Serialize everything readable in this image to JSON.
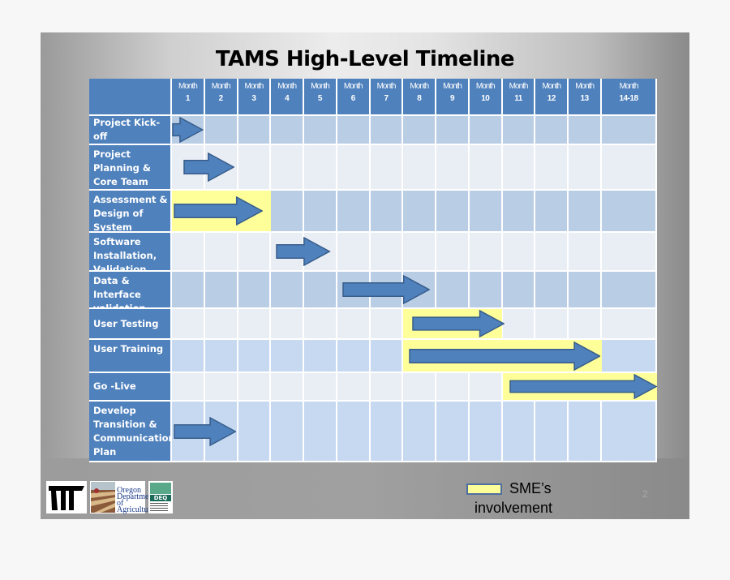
{
  "slide": {
    "title": "TAMS High-Level Timeline",
    "page_number": "2"
  },
  "header": {
    "corner": "",
    "months": [
      {
        "line1": "Month",
        "line2": "1"
      },
      {
        "line1": "Month",
        "line2": "2"
      },
      {
        "line1": "Month",
        "line2": "3"
      },
      {
        "line1": "Month",
        "line2": "4"
      },
      {
        "line1": "Month",
        "line2": "5"
      },
      {
        "line1": "Month",
        "line2": "6"
      },
      {
        "line1": "Month",
        "line2": "7"
      },
      {
        "line1": "Month",
        "line2": "8"
      },
      {
        "line1": "Month",
        "line2": "9"
      },
      {
        "line1": "Month",
        "line2": "10"
      },
      {
        "line1": "Month",
        "line2": "11"
      },
      {
        "line1": "Month",
        "line2": "12"
      },
      {
        "line1": "Month",
        "line2": "13"
      },
      {
        "line1": "Month",
        "line2": "14-18"
      }
    ]
  },
  "tasks": [
    {
      "label": "Project Kick-off",
      "arrow_start_month": 1.0,
      "arrow_end_month": 1.95,
      "sme_start_month": null,
      "sme_end_month": null
    },
    {
      "label": "Project Planning & Core Team Training",
      "arrow_start_month": 1.35,
      "arrow_end_month": 2.9,
      "sme_start_month": null,
      "sme_end_month": null
    },
    {
      "label": "Assessment & Design of System",
      "arrow_start_month": 1.05,
      "arrow_end_month": 3.75,
      "sme_start_month": 1.0,
      "sme_end_month": 3.99
    },
    {
      "label": "Software Installation, Validation",
      "arrow_start_month": 4.15,
      "arrow_end_month": 5.8,
      "sme_start_month": null,
      "sme_end_month": null
    },
    {
      "label": "Data & Interface validation",
      "arrow_start_month": 6.15,
      "arrow_end_month": 8.8,
      "sme_start_month": null,
      "sme_end_month": null
    },
    {
      "label": "User Testing",
      "arrow_start_month": 8.25,
      "arrow_end_month": 11.05,
      "sme_start_month": 8.0,
      "sme_end_month": 10.99
    },
    {
      "label": "User Training",
      "arrow_start_month": 8.15,
      "arrow_end_month": 13.95,
      "sme_start_month": 8.0,
      "sme_end_month": 13.99
    },
    {
      "label": "Go -Live",
      "arrow_start_month": 11.2,
      "arrow_end_month": 15.0,
      "sme_start_month": 11.0,
      "sme_end_month": 15.0
    },
    {
      "label": "Develop Transition & Communication Plan",
      "arrow_start_month": 1.05,
      "arrow_end_month": 2.95,
      "sme_start_month": null,
      "sme_end_month": null
    }
  ],
  "legend": {
    "swatch_color": "#ffff99",
    "line1": "SME’s",
    "line2": "involvement"
  },
  "logos": [
    {
      "name": "odot-logo",
      "text": ""
    },
    {
      "name": "oregon-agriculture-logo",
      "text": "Oregon Department of Agriculture"
    },
    {
      "name": "deq-logo",
      "text": "DEQ"
    }
  ],
  "colors": {
    "header_blue": "#4f81bd",
    "row_dark": "#b9cde5",
    "row_light": "#e9edf4",
    "sme_yellow": "#ffff99",
    "arrow_fill": "#4f81bd",
    "arrow_stroke": "#385d8a"
  }
}
